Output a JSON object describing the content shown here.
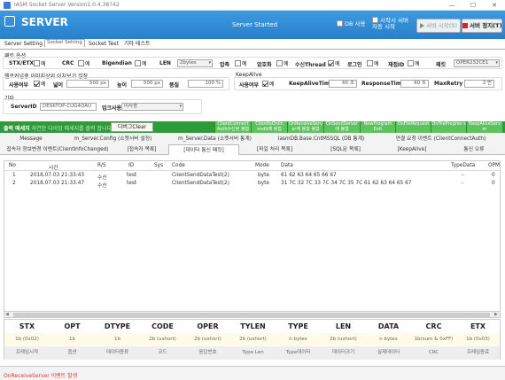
{
  "window": {
    "title": "IASM Socket Server Version1.0.4.38742",
    "minimize": "—",
    "maximize": "☐",
    "close": "✕"
  },
  "header": {
    "app_name": "SERVER",
    "status": "Server Started",
    "db_use_label": "DB 사용",
    "autostart_label": "시작시 서버 자동 시작",
    "start_button": "서버 시작(S)",
    "stop_button": "서버 정지(T)",
    "accent": "#2a7fca"
  },
  "tabs": [
    "Server Setting",
    "Socket Setting",
    "Socket Test",
    "기타 테스트"
  ],
  "settings": {
    "packet_section": "패킷 옵션",
    "stx_label": "STX/ETX",
    "crc_label": "CRC",
    "bigendian_label": "Bigendian",
    "len_label": "LEN",
    "len_value": "2bytes",
    "compress_label": "압축",
    "encrypt_label": "암호화",
    "recvthread_label": "수신Thread",
    "log_label": "로그인",
    "reconnect_label": "재접ID",
    "port_label": "패킷",
    "port_value": "OPER232CE1",
    "yes": "예",
    "dummy_section": "헬로커널중 이미지상위 이치보기 설정",
    "use_label": "사용여부",
    "width_label": "넓이",
    "width_value": "500 px",
    "height_label": "높이",
    "height_value": "500 px",
    "quality_label": "품질",
    "quality_value": "100 %",
    "keepalive_section": "KeepAlive",
    "ka_use_label": "사용여부",
    "ka_time_label": "KeepAliveTime",
    "ka_time_value": "60 초",
    "resp_label": "ResponseTime",
    "resp_value": "60 초",
    "retry_label": "MaxRetry",
    "retry_value": "3 번",
    "etc_section": "기타",
    "serverid_label": "ServerID",
    "serverid_value": "DESKTOP-CUG4QAU",
    "sort_label": "업크사용",
    "sort_value": "미사용"
  },
  "output": {
    "title": "출력 메세지",
    "hint": "자연한 다이잉 메세지를 출력 합니다",
    "clear_button": "디버그Clear",
    "events": [
      "ClientConnect Auth수신된 봉합",
      "ClientIsOnlin eodb에 봉합",
      "OnReceiveServ er에 봉합 봉합",
      "OnSendServer 에 봉합",
      "NewProgram Exit",
      "OnFileRequest",
      "OnFileProgres s",
      "KeepAliveServ er"
    ]
  },
  "logtabs": {
    "row1": [
      "Message",
      "m_Server.Config (소켓서버 설정)",
      "m_Server.Data (소켓서버 통계)",
      "IasmDB.Base.CntMSSQL (DB 통계)",
      "연결 요청 이벤트 (ClientConnectAuth)"
    ],
    "row2": [
      "접속자 정보변경 이벤트(ClientInfoChanged)",
      "[접속자 목록]",
      "[데이터 통신 패킷]",
      "[파일 처리 목록]",
      "[SQL문 목록]",
      "[KeepAlive]",
      "통신 오류"
    ]
  },
  "grid": {
    "columns": [
      "No",
      "시간",
      "R/S",
      "ID",
      "Sys",
      "Code",
      "Mode",
      "Data",
      "TypeData",
      "OPM"
    ],
    "rows": [
      [
        "1",
        "2018.07.03 21:33:43",
        "수신",
        "test",
        "",
        "ClientSendDataTest(2)",
        "byte",
        "61 62 63 64 65 66 67",
        "-",
        "0"
      ],
      [
        "2",
        "2018.07.03 21:33:47",
        "수신",
        "test",
        "",
        "ClientSendDataTest(2)",
        "byte",
        "31 7C 32 7C 33 7C 34 7C 35 7C 61 62 63 64 65 67",
        "-",
        "0"
      ]
    ]
  },
  "protocol": {
    "headers": [
      "STX",
      "OPT",
      "DTYPE",
      "CODE",
      "OPER",
      "TYLEN",
      "TYPE",
      "LEN",
      "DATA",
      "CRC",
      "ETX"
    ],
    "types": [
      "1b (0x02)",
      "1b",
      "1b",
      "2b (ushort)",
      "2b (ushort)",
      "2b (ushort)",
      "n bytes",
      "2b (ushort)",
      "n bytes",
      "1b(sum & 0xFF)",
      "1b (0x03)"
    ],
    "descs": [
      "프레임시작",
      "옵션",
      "데이터종류",
      "코드",
      "응답번호",
      "Type Len",
      "Type데이터",
      "데이터크기",
      "실제데이터",
      "CRC",
      "프레임종료"
    ]
  },
  "statusbar": {
    "text": "OnReceiveServer 이벤트 발생"
  }
}
